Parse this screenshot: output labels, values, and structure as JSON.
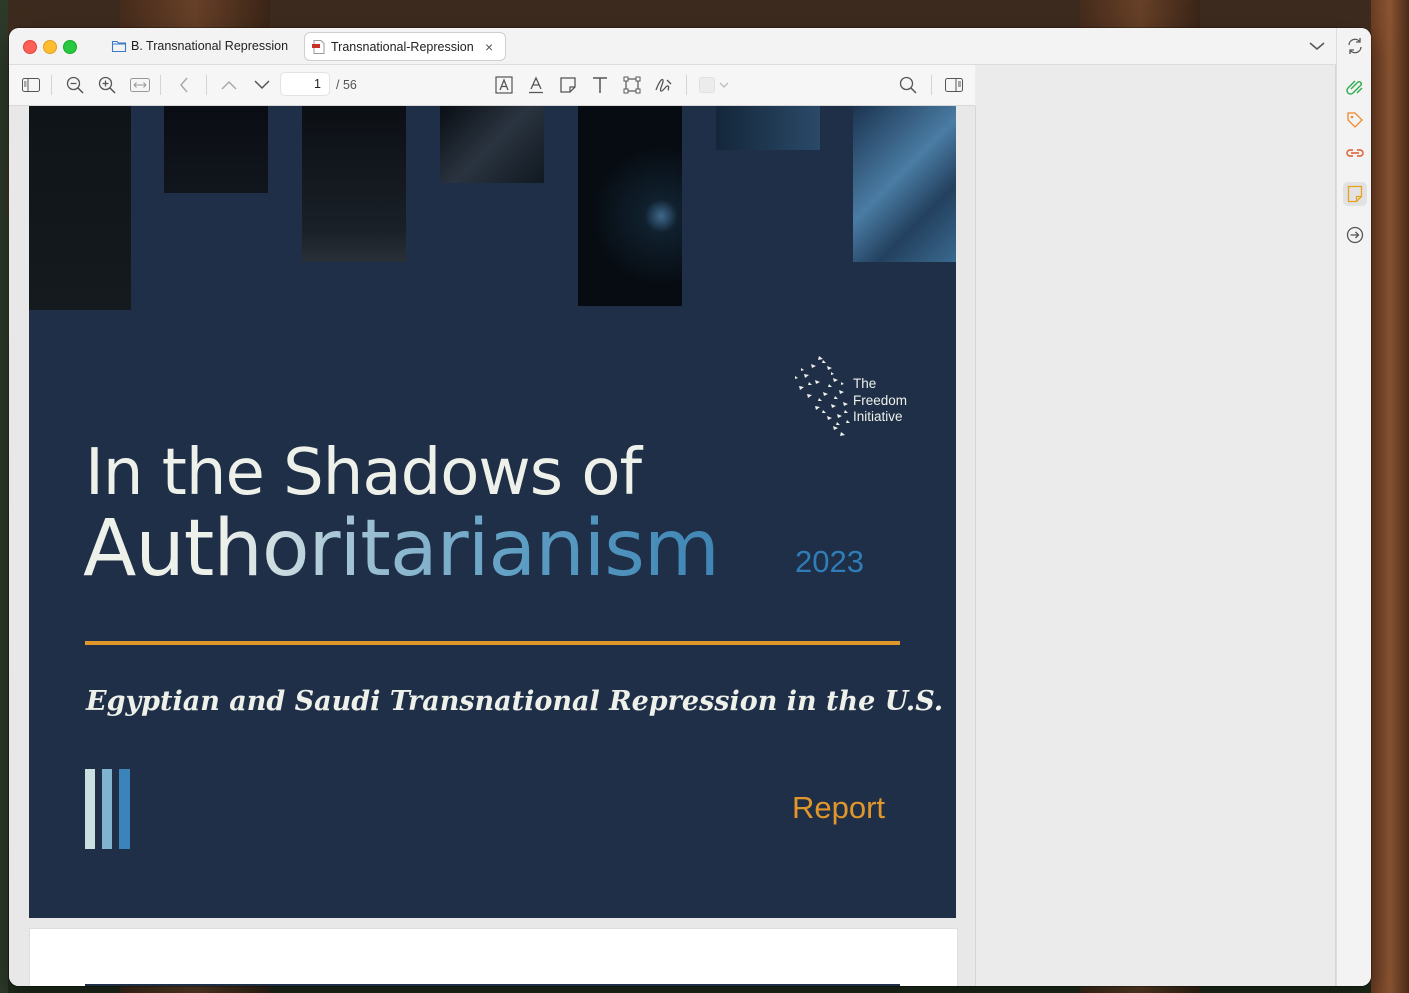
{
  "window": {
    "tabs": [
      {
        "label": "B. Transnational Repression",
        "icon": "folder-icon"
      },
      {
        "label": "Transnational-Repression",
        "icon": "pdf-icon",
        "close": "×"
      }
    ]
  },
  "toolbar": {
    "page_current": "1",
    "page_total": "/ 56",
    "buttons": [
      "sidebar-toggle-icon",
      "zoom-out-icon",
      "zoom-in-icon",
      "fit-width-icon",
      "back-icon",
      "page-up-icon",
      "page-down-icon",
      "text-box-icon",
      "text-underline-icon",
      "note-icon",
      "text-tool-icon",
      "select-area-icon",
      "signature-icon",
      "search-icon",
      "inspector-toggle-icon"
    ]
  },
  "document": {
    "title_line1": "In the Shadows of",
    "title_line2": "Authoritarianism",
    "year": "2023",
    "subtitle": "Egyptian and Saudi Transnational Repression in the U.S.",
    "report_label": "Report",
    "logo_lines": [
      "The",
      "Freedom",
      "Initiative"
    ]
  },
  "sidebar": {
    "buttons": [
      "refresh-icon",
      "paperclip-icon",
      "tag-icon",
      "link-icon",
      "sticky-note-icon",
      "follow-up-icon"
    ]
  },
  "colors": {
    "cover_bg": "#1f2f47",
    "accent_orange": "#e0962a",
    "accent_blue": "#2f7db8"
  }
}
